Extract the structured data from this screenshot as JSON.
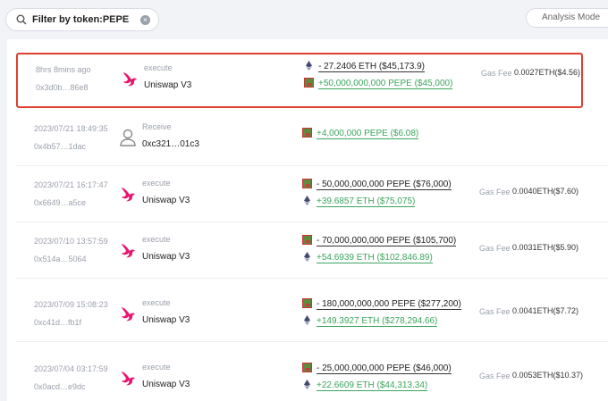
{
  "search": {
    "value": "Filter by token:PEPE"
  },
  "analysis_mode": {
    "label": "Analysis Mode"
  },
  "gas_label": "Gas Fee",
  "rows": [
    {
      "time": "8hrs 8mins ago",
      "hash": "0x3d0b…86e8",
      "action": "execute",
      "party": "Uniswap V3",
      "line1": "- 27.2406 ETH ($45,173.9)",
      "line2": "+50,000,000,000 PEPE ($45,000)",
      "gas": "0.0027ETH($4.56)"
    },
    {
      "time": "2023/07/21 18:49:35",
      "hash": "0x4b57…1dac",
      "action": "Receive",
      "party": "0xc321…01c3",
      "line1": "+4,000,000 PEPE ($6.08)"
    },
    {
      "time": "2023/07/21 16:17:47",
      "hash": "0x6649…a5ce",
      "action": "execute",
      "party": "Uniswap V3",
      "line1": "- 50,000,000,000 PEPE ($76,000)",
      "line2": "+39.6857 ETH ($75,075)",
      "gas": "0.0040ETH($7.60)"
    },
    {
      "time": "2023/07/10 13:57:59",
      "hash": "0x514a…5064",
      "action": "execute",
      "party": "Uniswap V3",
      "line1": "- 70,000,000,000 PEPE ($105,700)",
      "line2": "+54.6939 ETH ($102,846.89)",
      "gas": "0.0031ETH($5.90)"
    },
    {
      "time": "2023/07/09 15:08:23",
      "hash": "0xc41d…fb1f",
      "action": "execute",
      "party": "Uniswap V3",
      "line1": "- 180,000,000,000 PEPE ($277,200)",
      "line2": "+149.3927 ETH ($278,294.66)",
      "gas": "0.0041ETH($7.72)"
    },
    {
      "time": "2023/07/04 03:17:59",
      "hash": "0x0acd…e9dc",
      "action": "execute",
      "party": "Uniswap V3",
      "line1": "- 25,000,000,000 PEPE ($46,000)",
      "line2": "+22.6609 ETH ($44,313.34)",
      "gas": "0.0053ETH($10.37)"
    }
  ]
}
